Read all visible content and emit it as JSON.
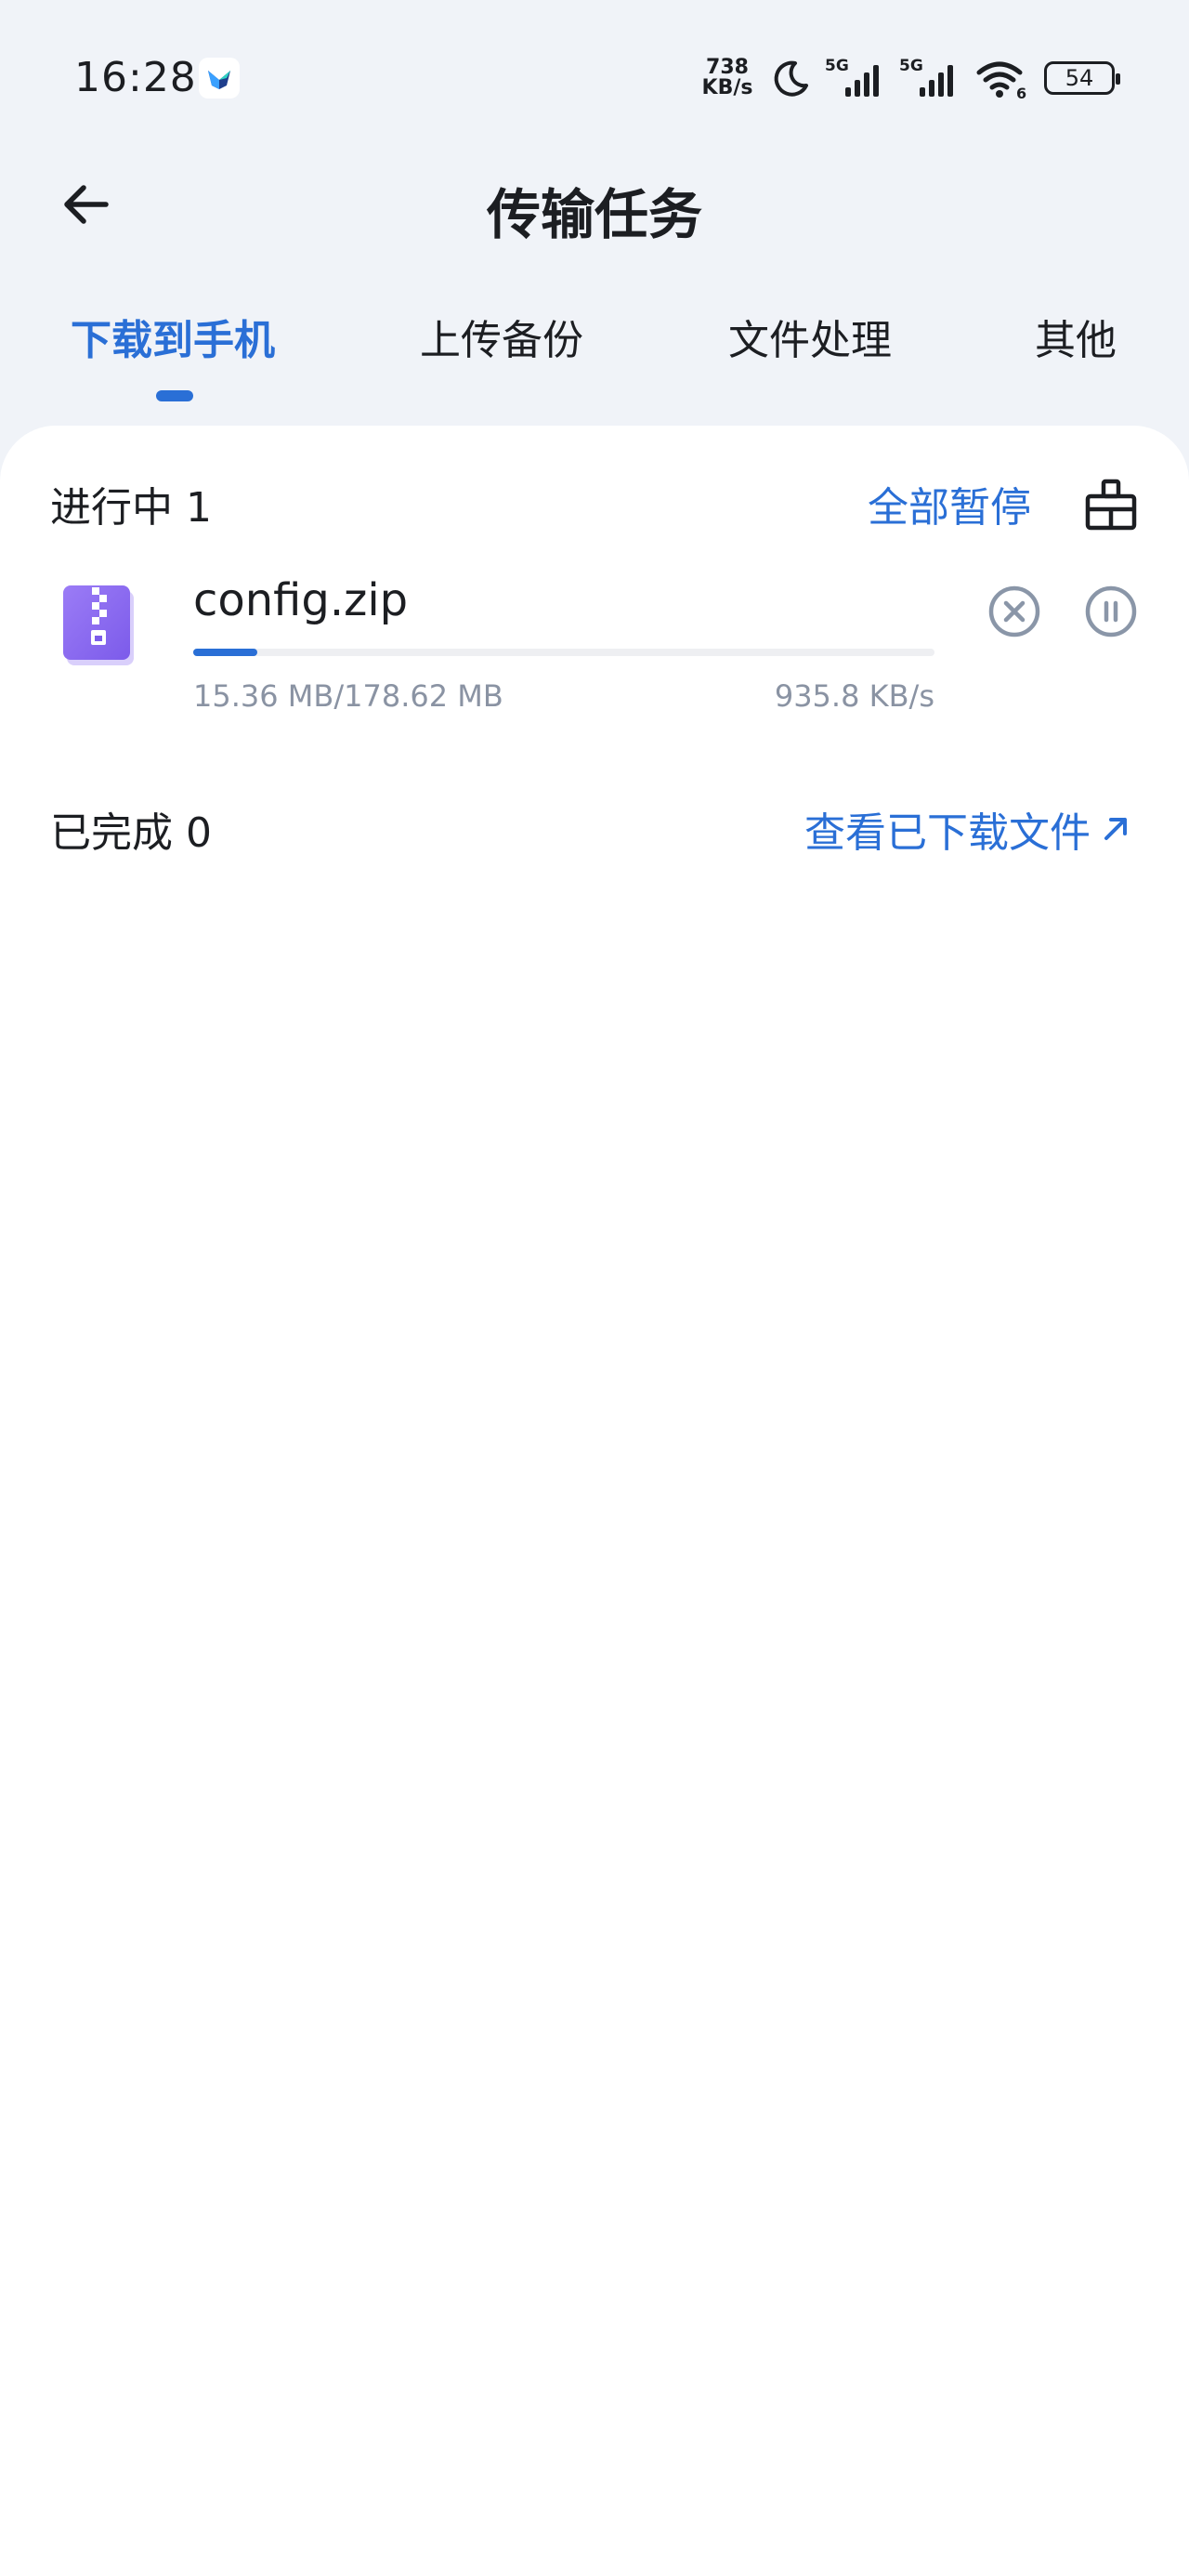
{
  "status_bar": {
    "time": "16:28",
    "net_speed_value": "738",
    "net_speed_unit": "KB/s",
    "signal_1_label": "5G",
    "signal_2_label": "5G",
    "wifi_badge": "6",
    "battery": "54",
    "icons": [
      "app-notification-icon",
      "moon-icon",
      "signal-icon",
      "wifi-icon",
      "battery-icon"
    ]
  },
  "header": {
    "title": "传输任务",
    "back_icon": "arrow-left-icon"
  },
  "tabs": [
    {
      "label": "下载到手机",
      "active": true
    },
    {
      "label": "上传备份",
      "active": false
    },
    {
      "label": "文件处理",
      "active": false
    },
    {
      "label": "其他",
      "active": false
    }
  ],
  "in_progress": {
    "title": "进行中 1",
    "pause_all_label": "全部暂停",
    "clear_icon": "broom-icon",
    "tasks": [
      {
        "file_name": "config.zip",
        "file_type_icon": "zip-file-icon",
        "size": "15.36 MB/178.62 MB",
        "speed": "935.8 KB/s",
        "progress": 0.086,
        "cancel_icon": "close-circle-icon",
        "pause_icon": "pause-circle-icon"
      }
    ]
  },
  "completed": {
    "title": "已完成 0",
    "view_files_label": "查看已下载文件",
    "view_files_icon": "arrow-up-right-icon"
  },
  "colors": {
    "accent": "#2a6fd6",
    "background": "#f0f3f8",
    "sheet": "#ffffff",
    "secondary_text": "#8a93a3",
    "icon_gray": "#8a96a8",
    "zip_purple": "#8a6df0"
  }
}
